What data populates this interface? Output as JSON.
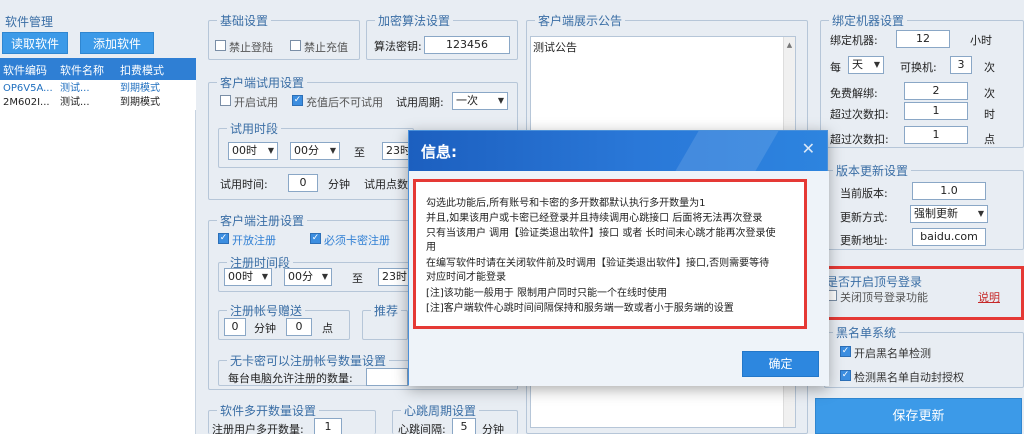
{
  "software": {
    "title": "软件管理",
    "read_btn": "读取软件",
    "add_btn": "添加软件",
    "columns": [
      "软件编码",
      "软件名称",
      "扣费模式"
    ],
    "rows": [
      {
        "code": "OP6V5A...",
        "name": "测试...",
        "mode": "到期模式"
      },
      {
        "code": "2M602I...",
        "name": "测试...",
        "mode": "到期模式"
      }
    ]
  },
  "basic": {
    "title": "基础设置",
    "forbid_login": "禁止登陆",
    "forbid_recharge": "禁止充值"
  },
  "encrypt": {
    "title": "加密算法设置",
    "key_label": "算法密钥:",
    "key_value": "123456"
  },
  "trial": {
    "title": "客户端试用设置",
    "open_trial": "开启试用",
    "no_trial_after_recharge": "充值后不可试用",
    "period_label": "试用周期:",
    "period_value": "一次",
    "time_period_title": "试用时段",
    "start_hour": "00时",
    "start_min": "00分",
    "to": "至",
    "end_hour": "23时",
    "time_label": "试用时间:",
    "time_value": "0",
    "minute": "分钟",
    "trial_points_label": "试用点数"
  },
  "register": {
    "title": "客户端注册设置",
    "open_register": "开放注册",
    "require_card": "必须卡密注册",
    "time_period_title": "注册时间段",
    "start_hour": "00时",
    "start_min": "00分",
    "to": "至",
    "end_hour": "23时",
    "gift_title": "注册帐号赠送",
    "gift_min_value": "0",
    "gift_min_unit": "分钟",
    "gift_pts_value": "0",
    "gift_pts_unit": "点",
    "recommend_title": "推荐",
    "nocard_title": "无卡密可以注册帐号数量设置",
    "per_pc_label": "每台电脑允许注册的数量:"
  },
  "multi": {
    "title": "软件多开数量设置",
    "label": "注册用户多开数量:",
    "value": "1"
  },
  "heartbeat": {
    "title": "心跳周期设置",
    "label": "心跳间隔:",
    "value": "5",
    "unit": "分钟"
  },
  "notice": {
    "title": "客户端展示公告",
    "text": "测试公告"
  },
  "bind": {
    "title": "绑定机器设置",
    "bind_label": "绑定机器:",
    "bind_value": "12",
    "bind_unit": "小时",
    "every_label": "每",
    "every_select": "天",
    "changeable_label": "可换机:",
    "changeable_value": "3",
    "changeable_unit": "次",
    "free_unbind_label": "免费解绑:",
    "free_unbind_value": "2",
    "free_unbind_unit": "次",
    "over_times_label1": "超过次数扣:",
    "over_times_value1": "1",
    "over_times_unit1": "时",
    "over_times_label2": "超过次数扣:",
    "over_times_value2": "1",
    "over_times_unit2": "点"
  },
  "version": {
    "title": "版本更新设置",
    "current_label": "当前版本:",
    "current_value": "1.0",
    "mode_label": "更新方式:",
    "mode_value": "强制更新",
    "url_label": "更新地址:",
    "url_value": "baidu.com"
  },
  "topup": {
    "title": "是否开启顶号登录",
    "close_label": "关闭顶号登录功能",
    "explain_link": "说明"
  },
  "blacklist": {
    "title": "黑名单系统",
    "detect": "开启黑名单检测",
    "auto_ban": "检测黑名单自动封授权"
  },
  "save_btn": "保存更新",
  "modal": {
    "title": "信息:",
    "close": "✕",
    "lines": [
      "勾选此功能后,所有账号和卡密的多开数都默认执行多开数量为1",
      "并且,如果该用户或卡密已经登录并且持续调用心跳接口  后面将无法再次登录",
      "只有当该用户 调用【验证类退出软件】接口 或者 长时间未心跳才能再次登录使",
      "用",
      "在编写软件时请在关闭软件前及时调用【验证类退出软件】接口,否则需要等待",
      "对应时间才能登录",
      "[注]该功能一般用于 限制用户同时只能一个在线时使用",
      "[注]客户端软件心跳时间间隔保持和服务端一致或者小于服务端的设置"
    ],
    "ok": "确定"
  },
  "colors": {
    "accent": "#3c9ae8",
    "header_blue": "#2f7fd4",
    "highlight_red": "#e53935",
    "group_title": "#3a6ea5"
  }
}
